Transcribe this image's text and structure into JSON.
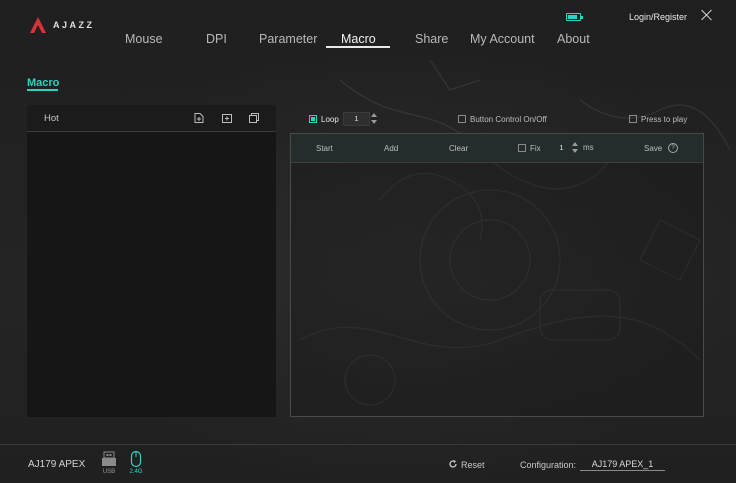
{
  "header": {
    "brand": "AJAZZ",
    "login_label": "Login/Register",
    "battery_level_pct": 70
  },
  "nav": {
    "tabs": [
      "Mouse",
      "DPI",
      "Parameter",
      "Macro",
      "Share",
      "My Account",
      "About"
    ],
    "active": "Macro"
  },
  "section": {
    "title": "Macro"
  },
  "left_panel": {
    "title": "Hot",
    "tools": [
      "new-file-icon",
      "import-folder-icon",
      "copy-icon"
    ]
  },
  "controls": {
    "loop_label": "Loop",
    "loop_checked": true,
    "loop_count": "1",
    "button_control_label": "Button Control On/Off",
    "button_control_checked": false,
    "press_to_play_label": "Press to play",
    "press_to_play_checked": false
  },
  "macro_toolbar": {
    "start_label": "Start",
    "add_label": "Add",
    "clear_label": "Clear",
    "fix_label": "Fix",
    "fix_checked": false,
    "fix_value": "1",
    "unit_label": "ms",
    "save_label": "Save",
    "help_glyph": "?"
  },
  "footer": {
    "device_name": "AJ179 APEX",
    "connections": [
      {
        "label": "USB",
        "active": false
      },
      {
        "label": "2.4G",
        "active": true
      }
    ],
    "reset_label": "Reset",
    "config_label": "Configuration:",
    "config_value": "AJ179 APEX_1"
  },
  "colors": {
    "accent": "#2ad4c0",
    "background": "#222222",
    "panel": "#161616"
  }
}
